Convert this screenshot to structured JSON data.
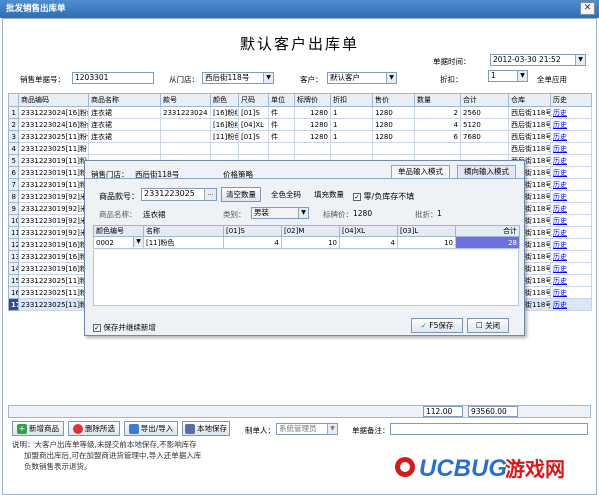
{
  "window": {
    "title": "批发销售出库单",
    "close": "✕"
  },
  "doc": {
    "title": "默认客户出库单",
    "time_label": "单据时间：",
    "time_value": "2012-03-30 21:52"
  },
  "header": {
    "no_label": "销售单据号：",
    "no_value": "1203301",
    "store_label": "从门店：",
    "store_value": "西后街118号",
    "customer_label": "客户：",
    "customer_value": "默认客户",
    "discount_label": "折扣：",
    "discount_value": "1",
    "apply_all": "全单应用"
  },
  "grid": {
    "columns": [
      "商品编码",
      "商品名称",
      "款号",
      "颜色",
      "尺码",
      "单位",
      "标牌价",
      "折扣",
      "售价",
      "数量",
      "合计",
      "仓库",
      "历史"
    ],
    "rows": [
      {
        "n": "1",
        "code": "2331223024[16]粉红",
        "name": "连衣裙",
        "style": "2331223024",
        "color": "[16]粉红",
        "size": "[01]S",
        "unit": "件",
        "tag": "1280",
        "disc": "1",
        "price": "1280",
        "qty": "2",
        "total": "2560",
        "wh": "西后街118号",
        "hist": "历史"
      },
      {
        "n": "2",
        "code": "2331223024[16]粉红",
        "name": "连衣裙",
        "style": "",
        "color": "[16]粉红",
        "size": "[04]XL",
        "unit": "件",
        "tag": "1280",
        "disc": "1",
        "price": "1280",
        "qty": "4",
        "total": "5120",
        "wh": "西后街118号",
        "hist": "历史"
      },
      {
        "n": "3",
        "code": "2331223025[11]粉色",
        "name": "连衣裙",
        "style": "",
        "color": "[11]粉色",
        "size": "[01]S",
        "unit": "件",
        "tag": "1280",
        "disc": "1",
        "price": "1280",
        "qty": "6",
        "total": "7680",
        "wh": "西后街118号",
        "hist": "历史"
      },
      {
        "n": "4",
        "code": "2331223025[11]粉",
        "name": "",
        "style": "",
        "color": "",
        "size": "",
        "unit": "",
        "tag": "",
        "disc": "",
        "price": "",
        "qty": "",
        "total": "",
        "wh": "西后街118号",
        "hist": "历史"
      },
      {
        "n": "5",
        "code": "2331223019[11]粉",
        "name": "",
        "style": "",
        "color": "",
        "size": "",
        "unit": "",
        "tag": "",
        "disc": "",
        "price": "",
        "qty": "",
        "total": "",
        "wh": "西后街118号",
        "hist": "历史"
      },
      {
        "n": "6",
        "code": "2331223019[11]粉",
        "name": "",
        "style": "",
        "color": "",
        "size": "",
        "unit": "",
        "tag": "",
        "disc": "",
        "price": "",
        "qty": "",
        "total": "",
        "wh": "西后街118号",
        "hist": "历史"
      },
      {
        "n": "7",
        "code": "2331223019[11]粉",
        "name": "",
        "style": "",
        "color": "",
        "size": "",
        "unit": "",
        "tag": "",
        "disc": "",
        "price": "",
        "qty": "",
        "total": "",
        "wh": "西后街118号",
        "hist": "历史"
      },
      {
        "n": "8",
        "code": "2331223019[92]米",
        "name": "",
        "style": "",
        "color": "",
        "size": "",
        "unit": "",
        "tag": "",
        "disc": "",
        "price": "",
        "qty": "",
        "total": "",
        "wh": "西后街118号",
        "hist": "历史"
      },
      {
        "n": "9",
        "code": "2331223019[92]米",
        "name": "",
        "style": "",
        "color": "",
        "size": "",
        "unit": "",
        "tag": "",
        "disc": "",
        "price": "",
        "qty": "",
        "total": "",
        "wh": "西后街118号",
        "hist": "历史"
      },
      {
        "n": "10",
        "code": "2331223019[92]米",
        "name": "",
        "style": "",
        "color": "",
        "size": "",
        "unit": "",
        "tag": "",
        "disc": "",
        "price": "",
        "qty": "",
        "total": "",
        "wh": "西后街118号",
        "hist": "历史"
      },
      {
        "n": "11",
        "code": "2331223019[92]米",
        "name": "",
        "style": "",
        "color": "",
        "size": "",
        "unit": "",
        "tag": "",
        "disc": "",
        "price": "",
        "qty": "",
        "total": "",
        "wh": "西后街118号",
        "hist": "历史"
      },
      {
        "n": "12",
        "code": "2331223019[16]粉",
        "name": "",
        "style": "",
        "color": "",
        "size": "",
        "unit": "",
        "tag": "",
        "disc": "",
        "price": "",
        "qty": "",
        "total": "",
        "wh": "西后街118号",
        "hist": "历史"
      },
      {
        "n": "13",
        "code": "2331223019[16]粉",
        "name": "",
        "style": "",
        "color": "",
        "size": "",
        "unit": "",
        "tag": "",
        "disc": "",
        "price": "",
        "qty": "",
        "total": "",
        "wh": "西后街118号",
        "hist": "历史"
      },
      {
        "n": "14",
        "code": "2331223019[16]粉",
        "name": "",
        "style": "",
        "color": "",
        "size": "",
        "unit": "",
        "tag": "",
        "disc": "",
        "price": "",
        "qty": "",
        "total": "",
        "wh": "西后街118号",
        "hist": "历史"
      },
      {
        "n": "15",
        "code": "2331223025[11]粉",
        "name": "",
        "style": "",
        "color": "",
        "size": "",
        "unit": "",
        "tag": "",
        "disc": "",
        "price": "",
        "qty": "",
        "total": "",
        "wh": "西后街118号",
        "hist": "历史"
      },
      {
        "n": "16",
        "code": "2331223025[11]粉",
        "name": "",
        "style": "",
        "color": "",
        "size": "",
        "unit": "",
        "tag": "",
        "disc": "",
        "price": "",
        "qty": "",
        "total": "",
        "wh": "西后街118号",
        "hist": "历史"
      },
      {
        "n": "17",
        "code": "2331223025[11]粉",
        "name": "",
        "style": "",
        "color": "",
        "size": "",
        "unit": "",
        "tag": "",
        "disc": "",
        "price": "",
        "qty": "",
        "total": "",
        "wh": "西后街118号",
        "hist": "历史"
      }
    ]
  },
  "totals": {
    "qty": "112.00",
    "amount": "93560.00"
  },
  "toolbar": {
    "add": "新增商品",
    "delete": "删除所选",
    "export": "导出/导入",
    "save_local": "本地保存"
  },
  "footer": {
    "maker_label": "制单人：",
    "maker_value": "系统管理员",
    "remark_label": "单据备注：",
    "remark_value": "",
    "note1": "说明：大客户出库单等级,未提交前本地保存,不影响库存",
    "note2": "加盟商出库后,可在加盟商进货管理中,导入还单据入库",
    "note3": "负数销售表示退货。"
  },
  "dialog": {
    "store_label": "销售门店：",
    "store_value": "西后街118号",
    "price_policy": "价格策略",
    "tab1": "单品输入模式",
    "tab2": "横向输入模式",
    "style_label": "商品款号：",
    "style_value": "2331223025",
    "btn_ellipsis": "...",
    "btn_clear": "清空数量",
    "btn_allcolor": "全色全码",
    "btn_fill": "填充数量",
    "neg_stock": "零/负库存不填",
    "name_label": "商品名称：",
    "name_value": "连衣裙",
    "cat_label": "类别：",
    "cat_value": "男装",
    "tag_label": "标牌价：",
    "tag_value": "1280",
    "batch_label": "批折：",
    "batch_value": "1",
    "cols": [
      "颜色编号",
      "名称",
      "[01]S",
      "[02]M",
      "[04]XL",
      "[03]L",
      "合计"
    ],
    "row": {
      "code": "0002",
      "name": "[11]粉色",
      "s": "4",
      "m": "10",
      "xl": "4",
      "l": "10",
      "total": "28"
    },
    "save_continue": "保存并继续新增",
    "btn_save": "F5保存",
    "btn_close": "关闭"
  },
  "watermark": {
    "text": "UCBUG游戏网"
  }
}
